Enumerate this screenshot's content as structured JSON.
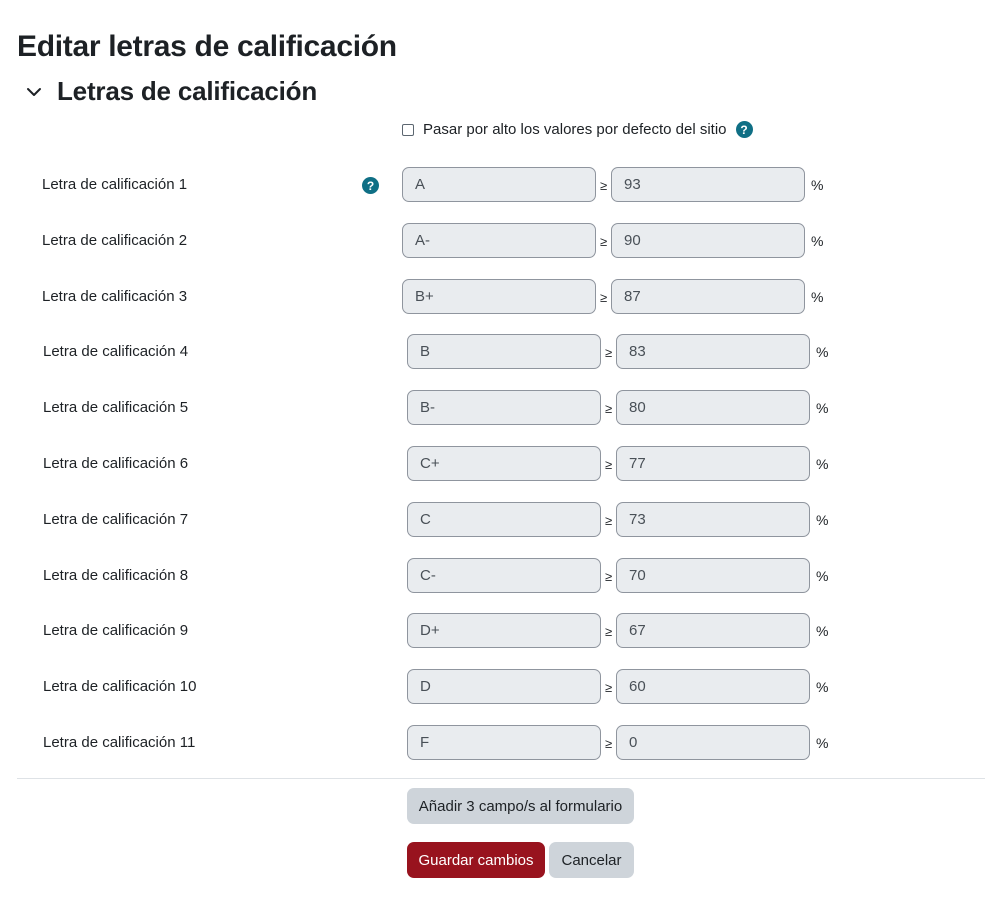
{
  "page": {
    "title": "Editar letras de calificación"
  },
  "section": {
    "title": "Letras de calificación",
    "toggle_icon": "chevron-down-icon"
  },
  "override": {
    "label": "Pasar por alto los valores por defecto del sitio",
    "checked": false,
    "help_icon": "question-circle-icon",
    "help_glyph": "?"
  },
  "grade_letters": {
    "symbol_ge": "≥",
    "symbol_percent": "%",
    "help_glyph": "?",
    "rows": [
      {
        "label": "Letra de calificación 1",
        "letter": "A",
        "boundary": "93"
      },
      {
        "label": "Letra de calificación 2",
        "letter": "A-",
        "boundary": "90"
      },
      {
        "label": "Letra de calificación 3",
        "letter": "B+",
        "boundary": "87"
      },
      {
        "label": "Letra de calificación 4",
        "letter": "B",
        "boundary": "83"
      },
      {
        "label": "Letra de calificación 5",
        "letter": "B-",
        "boundary": "80"
      },
      {
        "label": "Letra de calificación 6",
        "letter": "C+",
        "boundary": "77"
      },
      {
        "label": "Letra de calificación 7",
        "letter": "C",
        "boundary": "73"
      },
      {
        "label": "Letra de calificación 8",
        "letter": "C-",
        "boundary": "70"
      },
      {
        "label": "Letra de calificación 9",
        "letter": "D+",
        "boundary": "67"
      },
      {
        "label": "Letra de calificación 10",
        "letter": "D",
        "boundary": "60"
      },
      {
        "label": "Letra de calificación 11",
        "letter": "F",
        "boundary": "0"
      }
    ]
  },
  "actions": {
    "add_fields": "Añadir 3 campo/s al formulario",
    "save": "Guardar cambios",
    "cancel": "Cancelar"
  },
  "colors": {
    "primary": "#98131e",
    "secondary": "#ced4da",
    "help": "#0f6f85",
    "input_bg": "#e9ecef"
  }
}
